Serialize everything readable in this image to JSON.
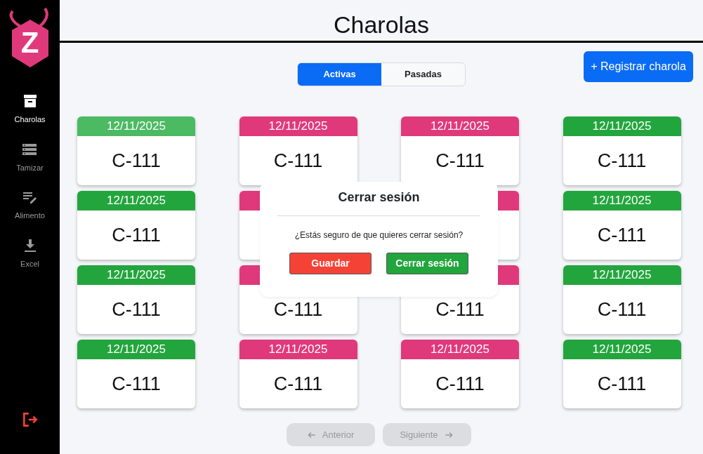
{
  "sidebar": {
    "logo": {
      "letter": "Z"
    },
    "items": [
      {
        "label": "Charolas",
        "selected": true
      },
      {
        "label": "Tamizar",
        "selected": false
      },
      {
        "label": "Alimento",
        "selected": false
      },
      {
        "label": "Excel",
        "selected": false
      }
    ]
  },
  "header": {
    "title": "Charolas"
  },
  "tabs": [
    {
      "label": "Activas",
      "selected": true
    },
    {
      "label": "Pasadas",
      "selected": false
    }
  ],
  "register_button": {
    "label": "+ Registrar charola"
  },
  "cards": [
    {
      "date": "12/11/2025",
      "code": "C-111",
      "color": "#4cb963"
    },
    {
      "date": "12/11/2025",
      "code": "C-111",
      "color": "#e0397b"
    },
    {
      "date": "12/11/2025",
      "code": "C-111",
      "color": "#e0397b"
    },
    {
      "date": "12/11/2025",
      "code": "C-111",
      "color": "#23a53d"
    },
    {
      "date": "12/11/2025",
      "code": "C-111",
      "color": "#23a53d"
    },
    {
      "color": "#e0397b"
    },
    {
      "color": "#e0397b"
    },
    {
      "date": "12/11/2025",
      "code": "C-111",
      "color": "#23a53d"
    },
    {
      "date": "12/11/2025",
      "code": "C-111",
      "color": "#23a53d"
    },
    {
      "code": "C-111",
      "color": "#e0397b"
    },
    {
      "code": "C-111",
      "color": "#e0397b"
    },
    {
      "date": "12/11/2025",
      "code": "C-111",
      "color": "#23a53d"
    },
    {
      "date": "12/11/2025",
      "code": "C-111",
      "color": "#23a53d"
    },
    {
      "date": "12/11/2025",
      "code": "C-111",
      "color": "#e0397b"
    },
    {
      "date": "12/11/2025",
      "code": "C-111",
      "color": "#e0397b"
    },
    {
      "date": "12/11/2025",
      "code": "C-111",
      "color": "#23a53d"
    }
  ],
  "dialog": {
    "title": "Cerrar sesión",
    "message": "¿Estás seguro de que quieres cerrar sesión?",
    "buttons": [
      {
        "label": "Guardar",
        "kind": "danger"
      },
      {
        "label": "Cerrar sesión",
        "kind": "success"
      }
    ]
  },
  "pagination": [
    {
      "label": "Anterior",
      "kind": "previous",
      "disabled": true
    },
    {
      "label": "Siguiente",
      "kind": "next",
      "disabled": true
    }
  ]
}
